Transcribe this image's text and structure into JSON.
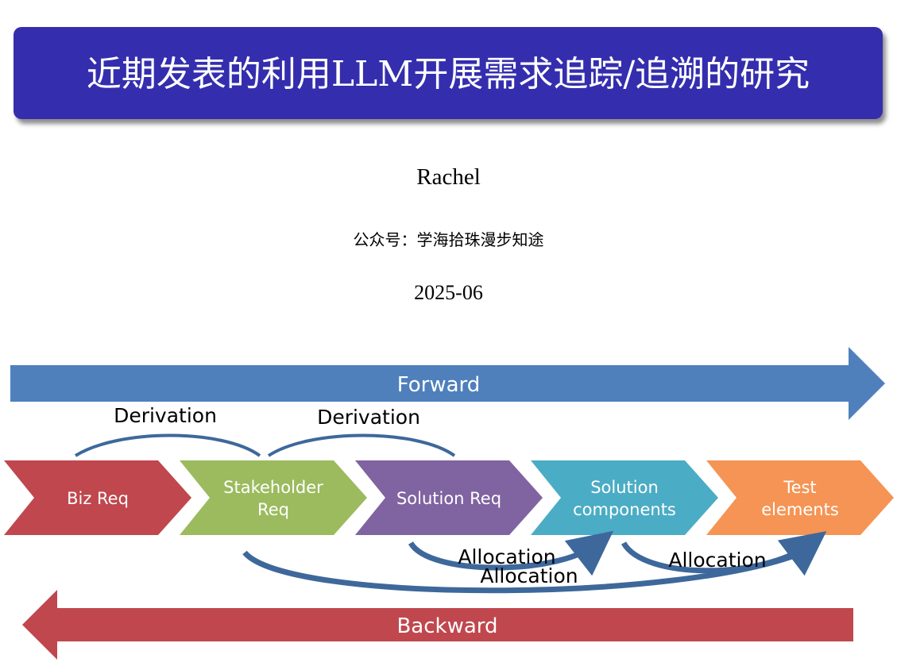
{
  "title": "近期发表的利用LLM开展需求追踪/追溯的研究",
  "author": "Rachel",
  "account": "公众号：学海拾珠漫步知途",
  "date": "2025-06",
  "diagram": {
    "forward_label": "Forward",
    "backward_label": "Backward",
    "stages": [
      {
        "line1": "Biz Req",
        "line2": "",
        "color": "#c0474e"
      },
      {
        "line1": "Stakeholder",
        "line2": "Req",
        "color": "#9bbb5e"
      },
      {
        "line1": "Solution Req",
        "line2": "",
        "color": "#8063a1"
      },
      {
        "line1": "Solution",
        "line2": "components",
        "color": "#4bacc5"
      },
      {
        "line1": "Test",
        "line2": "elements",
        "color": "#f59454"
      }
    ],
    "derivation_labels": [
      "Derivation",
      "Derivation"
    ],
    "allocation_labels": [
      "Allocation",
      "Allocation",
      "Allocation"
    ],
    "colors": {
      "forward": "#4f80bc",
      "backward": "#c0474e",
      "connector": "#3e689b",
      "title_bg": "#342eae"
    }
  }
}
